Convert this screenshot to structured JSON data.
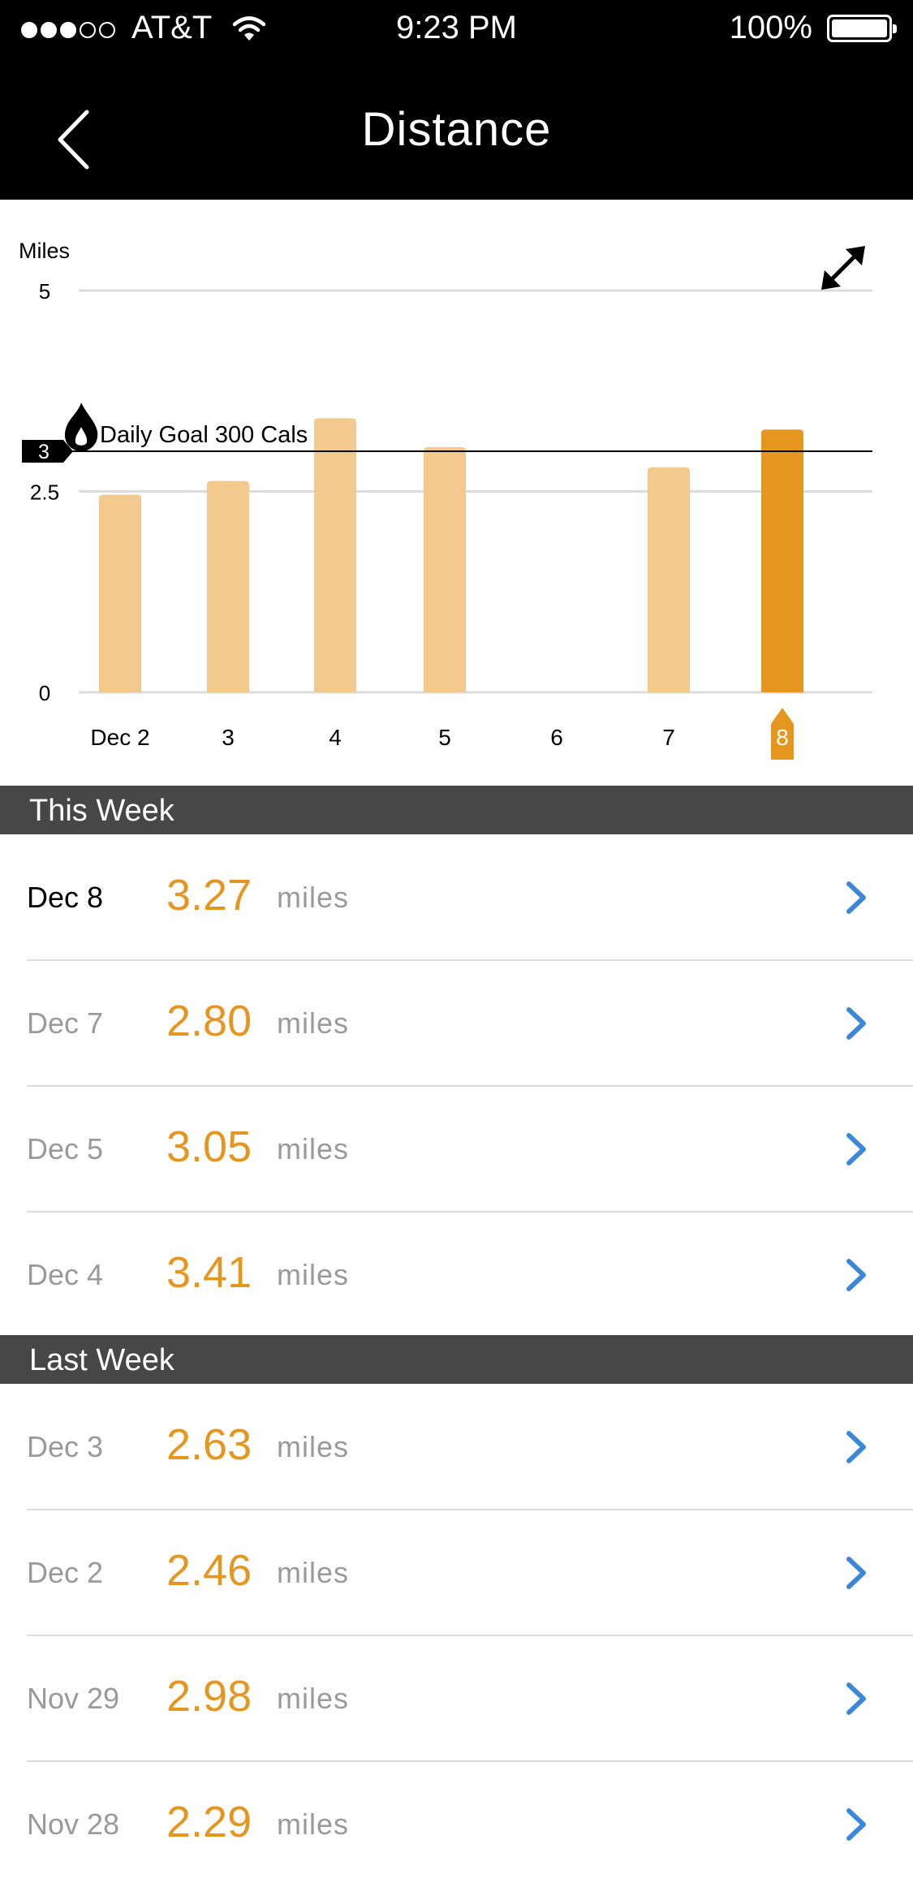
{
  "status_bar": {
    "carrier": "AT&T",
    "time": "9:23 PM",
    "battery": "100%",
    "signal_bars_filled": 3,
    "signal_bars_total": 5
  },
  "nav": {
    "title": "Distance",
    "back_icon": "chevron-left-icon"
  },
  "chart_data": {
    "type": "bar",
    "ylabel": "Miles",
    "yticks": [
      "5",
      "2.5",
      "0"
    ],
    "ylim": [
      0,
      5
    ],
    "categories": [
      "Dec 2",
      "3",
      "4",
      "5",
      "6",
      "7",
      "8"
    ],
    "values": [
      2.46,
      2.63,
      3.41,
      3.05,
      0,
      2.8,
      3.27
    ],
    "selected_category": "8",
    "goal": {
      "value": 3,
      "tag": "3",
      "label": "Daily Goal 300 Cals",
      "icon": "flame-icon"
    },
    "colors": {
      "bar": "#f3c98d",
      "selected_bar": "#e5961e",
      "grid": "#dcdcdc",
      "goal_line": "#000000"
    },
    "expand_icon": "expand-arrows-icon"
  },
  "sections": [
    {
      "title": "This Week",
      "rows": [
        {
          "date": "Dec 8",
          "value": "3.27",
          "unit": "miles",
          "current": true
        },
        {
          "date": "Dec 7",
          "value": "2.80",
          "unit": "miles"
        },
        {
          "date": "Dec 5",
          "value": "3.05",
          "unit": "miles"
        },
        {
          "date": "Dec 4",
          "value": "3.41",
          "unit": "miles"
        }
      ]
    },
    {
      "title": "Last Week",
      "rows": [
        {
          "date": "Dec 3",
          "value": "2.63",
          "unit": "miles"
        },
        {
          "date": "Dec 2",
          "value": "2.46",
          "unit": "miles"
        },
        {
          "date": "Nov 29",
          "value": "2.98",
          "unit": "miles"
        },
        {
          "date": "Nov 28",
          "value": "2.29",
          "unit": "miles"
        }
      ]
    }
  ],
  "colors": {
    "accent": "#e5961e",
    "link": "#3b87d8",
    "section_header": "#474747"
  }
}
